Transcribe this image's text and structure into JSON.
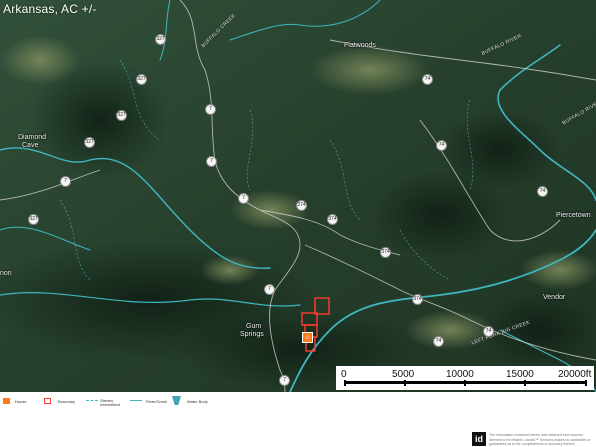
{
  "map": {
    "title": "Arkansas,  AC +/-",
    "places": {
      "flatwoods": "Flatwoods",
      "diamond_cave_1": "Diamond",
      "diamond_cave_2": "Cave",
      "piercetown": "Piercetown",
      "vendor": "Vendor",
      "gum_springs_1": "Gum",
      "gum_springs_2": "Springs",
      "non": "non"
    },
    "road_names": {
      "buffalo_creek": "BUFFALO CREEK",
      "buffalo_river": "BUFFALO RIVER",
      "left_creek": "LEFT FORK BIG CREEK",
      "big_creek": "BUFFALO RIVER"
    },
    "route_shields": {
      "r1": "7",
      "r2": "7",
      "r3": "7",
      "r4": "7",
      "r5": "7",
      "r6": "327",
      "r7": "327",
      "r8": "327",
      "r9": "327",
      "r10": "327",
      "r11": "74",
      "r12": "74",
      "r13": "374",
      "r14": "374",
      "r15": "374",
      "r16": "374",
      "r17": "74",
      "r18": "74",
      "r19": "74",
      "r20": "7"
    },
    "scale": {
      "labels": [
        "0",
        "5000",
        "10000",
        "15000",
        "20000ft"
      ]
    },
    "house_glyph": "⌂"
  },
  "legend": {
    "house": "House",
    "boundary": "Boundary",
    "stream": "Stream, Intermittent",
    "river": "River/Creek",
    "water_body": "Water Body"
  },
  "footer": {
    "brand": "id",
    "disclaimer": "The information contained herein was obtained from sources deemed to be reliable. LandId™ Services makes no warranties or guarantees as to the completeness or accuracy thereof."
  },
  "colors": {
    "terrain_dark": "#1c3122",
    "terrain_mid": "#2f4a32",
    "terrain_light": "#5b6c4a",
    "river": "#3fb6c0",
    "boundary": "#ff3b2f",
    "house": "#ff7a1a"
  }
}
